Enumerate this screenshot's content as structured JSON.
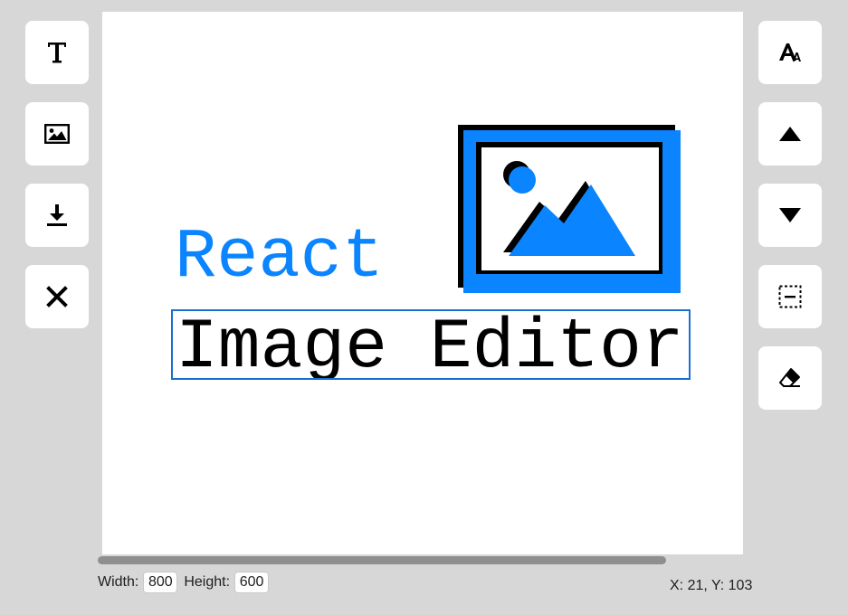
{
  "canvas": {
    "react_text": "React",
    "editor_text": "Image Editor",
    "colors": {
      "accent": "#0a84ff",
      "selection_border": "#1a6fd1",
      "text": "#000000",
      "background": "#d7d7d7"
    }
  },
  "left_toolbar": [
    {
      "icon": "text-icon"
    },
    {
      "icon": "image-icon"
    },
    {
      "icon": "download-icon"
    },
    {
      "icon": "close-icon"
    }
  ],
  "right_toolbar": [
    {
      "icon": "font-size-icon"
    },
    {
      "icon": "triangle-up-icon"
    },
    {
      "icon": "triangle-down-icon"
    },
    {
      "icon": "dashed-square-minus-icon"
    },
    {
      "icon": "eraser-icon"
    }
  ],
  "footer": {
    "width_label": "Width:",
    "width_value": "800",
    "height_label": "Height:",
    "height_value": "600",
    "coordinates": "X: 21, Y: 103"
  }
}
